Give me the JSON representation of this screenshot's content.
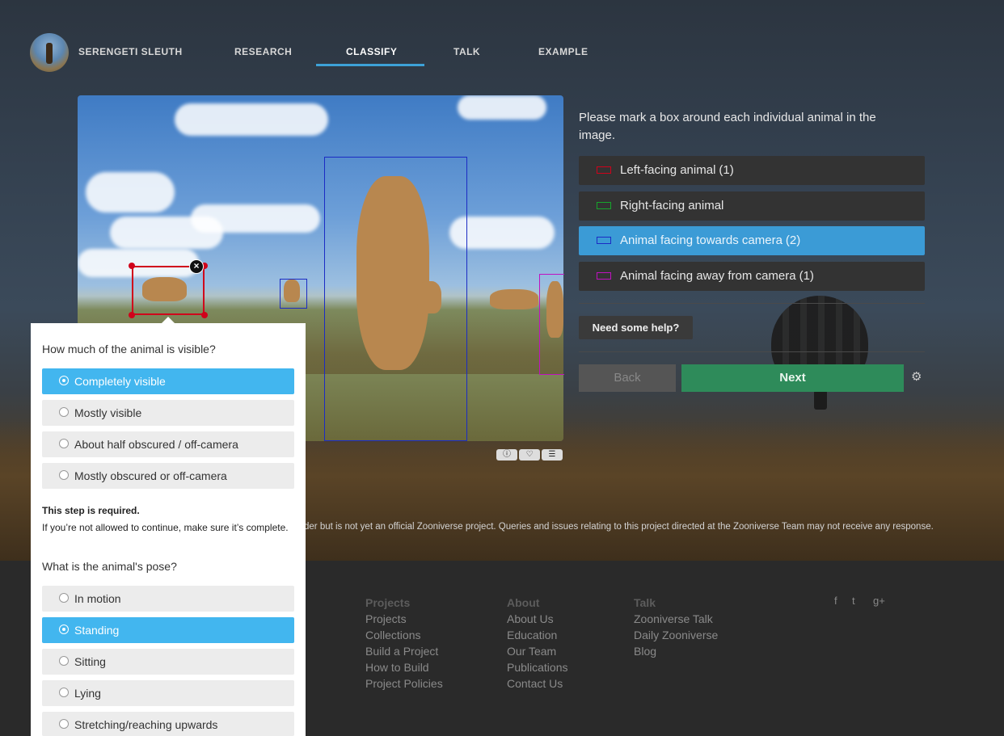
{
  "colors": {
    "accent": "#3da2d8",
    "next": "#2e8b5a",
    "selected": "#42b6ef",
    "tool_red": "#d0021b",
    "tool_green": "#16a52b",
    "tool_blue": "#1b2bc4",
    "tool_magenta": "#c012c0"
  },
  "header": {
    "project_name": "SERENGETI SLEUTH",
    "nav": [
      "RESEARCH",
      "CLASSIFY",
      "TALK",
      "EXAMPLE"
    ],
    "active_nav": "CLASSIFY"
  },
  "task": {
    "instructions": "Please mark a box around each individual animal in the image.",
    "tools": [
      {
        "label": "Left-facing animal",
        "count": "(1)",
        "color": "#d0021b"
      },
      {
        "label": "Right-facing animal",
        "count": "",
        "color": "#16a52b"
      },
      {
        "label": "Animal facing towards camera",
        "count": "(2)",
        "color": "#1b2bc4"
      },
      {
        "label": "Animal facing away from camera",
        "count": "(1)",
        "color": "#c012c0"
      }
    ],
    "help_label": "Need some help?",
    "back_label": "Back",
    "next_label": "Next"
  },
  "subject_icons": [
    "info-icon",
    "heart-icon",
    "list-icon"
  ],
  "popup": {
    "q1": "How much of the animal is visible?",
    "q1_answers": [
      "Completely visible",
      "Mostly visible",
      "About half obscured / off-camera",
      "Mostly obscured or off-camera"
    ],
    "q1_selected": "Completely visible",
    "required_title": "This step is required.",
    "required_text": "If you’re not allowed to continue, make sure it’s complete.",
    "q2": "What is the animal's pose?",
    "q2_answers": [
      "In motion",
      "Standing",
      "Sitting",
      "Lying",
      "Stretching/reaching upwards"
    ],
    "q2_selected": "Standing"
  },
  "disclaimer": "der but is not yet an official Zooniverse project. Queries and issues relating to this project directed at the Zooniverse Team may not receive any response.",
  "footer": {
    "projects": {
      "heading": "Projects",
      "links": [
        "Projects",
        "Collections",
        "Build a Project",
        "How to Build",
        "Project Policies"
      ]
    },
    "about": {
      "heading": "About",
      "links": [
        "About Us",
        "Education",
        "Our Team",
        "Publications",
        "Contact Us"
      ]
    },
    "talk": {
      "heading": "Talk",
      "links": [
        "Zooniverse Talk",
        "Daily Zooniverse",
        "Blog"
      ]
    },
    "social": [
      "f",
      "t",
      "g+"
    ]
  }
}
